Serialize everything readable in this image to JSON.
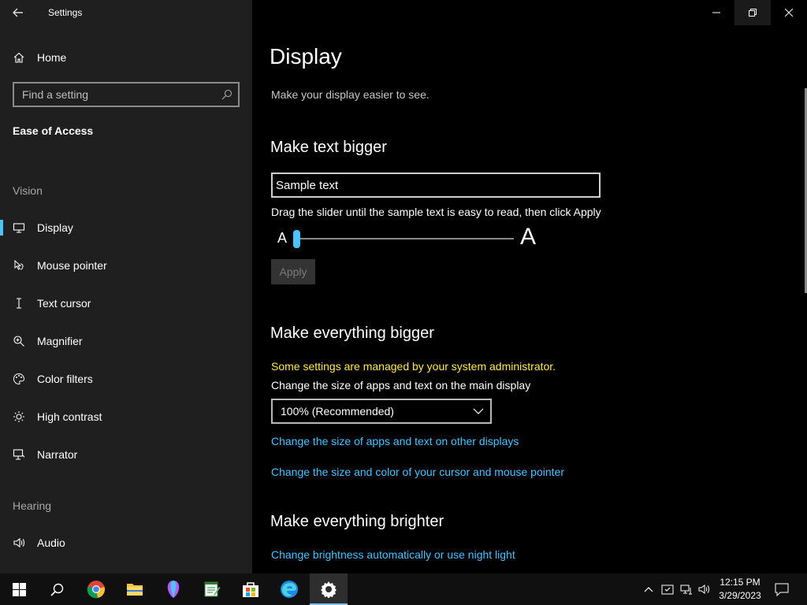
{
  "window": {
    "title": "Settings",
    "buttons": {
      "minimize": "minimize-icon",
      "restore": "restore-icon",
      "close": "close-icon"
    }
  },
  "sidebar": {
    "home": "Home",
    "search_placeholder": "Find a setting",
    "category": "Ease of Access",
    "vision_label": "Vision",
    "items": [
      {
        "label": "Display",
        "icon": "monitor-icon",
        "selected": true
      },
      {
        "label": "Mouse pointer",
        "icon": "mouse-pointer-icon"
      },
      {
        "label": "Text cursor",
        "icon": "text-cursor-icon"
      },
      {
        "label": "Magnifier",
        "icon": "magnifier-icon"
      },
      {
        "label": "Color filters",
        "icon": "palette-icon"
      },
      {
        "label": "High contrast",
        "icon": "sun-icon"
      },
      {
        "label": "Narrator",
        "icon": "narrator-icon"
      }
    ],
    "hearing_label": "Hearing",
    "hearing_items": [
      {
        "label": "Audio",
        "icon": "speaker-icon"
      }
    ]
  },
  "main": {
    "title": "Display",
    "subtitle": "Make your display easier to see.",
    "text_section": {
      "title": "Make text bigger",
      "sample": "Sample text",
      "hint": "Drag the slider until the sample text is easy to read, then click Apply",
      "small_a": "A",
      "large_a": "A",
      "slider_percent": 0,
      "apply": "Apply"
    },
    "everything_section": {
      "title": "Make everything bigger",
      "warning": "Some settings are managed by your system administrator.",
      "label": "Change the size of apps and text on the main display",
      "dropdown_value": "100% (Recommended)",
      "link1": "Change the size of apps and text on other displays",
      "link2": "Change the size and color of your cursor and mouse pointer"
    },
    "brighter_section": {
      "title": "Make everything brighter",
      "link": "Change brightness automatically or use night light"
    }
  },
  "taskbar": {
    "apps": [
      "windows-start-icon",
      "search-icon",
      "chrome-icon",
      "file-explorer-icon",
      "paint3d-icon",
      "notepad-icon",
      "store-icon",
      "edge-icon",
      "settings-icon"
    ],
    "time": "12:15 PM",
    "date": "3/29/2023"
  },
  "colors": {
    "accent": "#4cc2ff",
    "warning": "#ffea5a",
    "sidebar_bg": "#1f1f1f",
    "main_bg": "#000000"
  }
}
